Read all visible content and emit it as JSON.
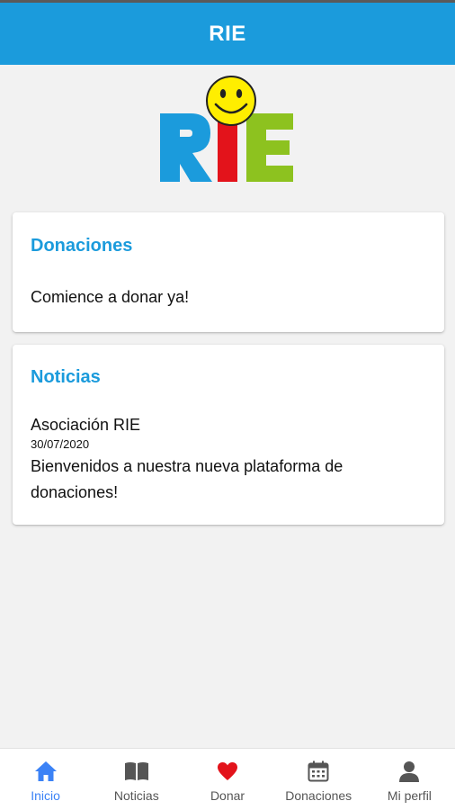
{
  "header": {
    "title": "RIE"
  },
  "logo": {
    "text": "RIE"
  },
  "cards": {
    "donaciones": {
      "title": "Donaciones",
      "body": "Comience a donar ya!"
    },
    "noticias": {
      "title": "Noticias",
      "author": "Asociación RIE",
      "date": "30/07/2020",
      "text": "Bienvenidos a nuestra nueva plataforma de donaciones!"
    }
  },
  "tabbar": {
    "active_color": "#3b82f6",
    "items": [
      {
        "label": "Inicio",
        "icon": "home-icon",
        "active": true
      },
      {
        "label": "Noticias",
        "icon": "book-icon",
        "active": false
      },
      {
        "label": "Donar",
        "icon": "heart-icon",
        "active": false
      },
      {
        "label": "Donaciones",
        "icon": "calendar-icon",
        "active": false
      },
      {
        "label": "Mi perfil",
        "icon": "person-icon",
        "active": false
      }
    ]
  },
  "colors": {
    "header": "#1b9bdc",
    "card_title": "#1b9bdc",
    "logo_r": "#1b9bdc",
    "logo_i": "#e3131b",
    "logo_e": "#8dc21f",
    "smiley": "#ffee00"
  }
}
